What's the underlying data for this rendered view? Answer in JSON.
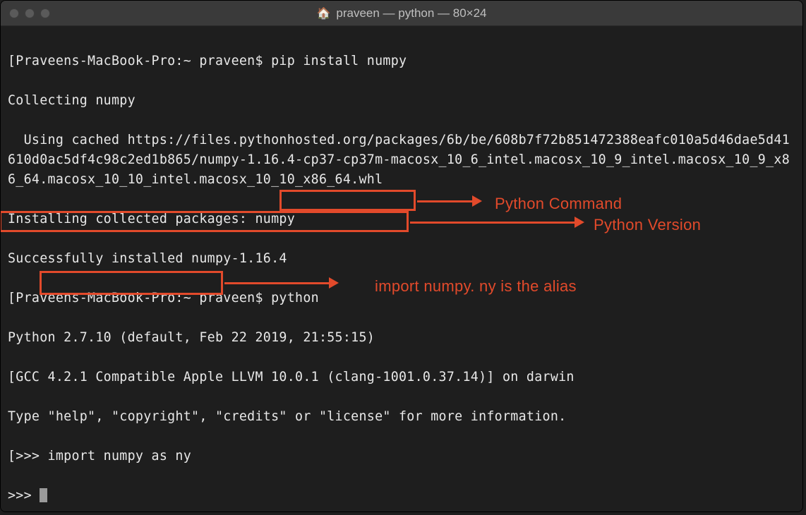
{
  "window": {
    "title": "praveen — python — 80×24",
    "home_icon": "🏠"
  },
  "terminal": {
    "lines": {
      "l0_prompt_prefix": "[Praveens-MacBook-Pro:~ praveen$ ",
      "l0_cmd": "pip install numpy",
      "l1": "Collecting numpy",
      "l2": "  Using cached https://files.pythonhosted.org/packages/6b/be/608b7f72b851472388eafc010a5d46dae5d41610d0ac5df4c98c2ed1b865/numpy-1.16.4-cp37-cp37m-macosx_10_6_intel.macosx_10_9_intel.macosx_10_9_x86_64.macosx_10_10_intel.macosx_10_10_x86_64.whl",
      "l3": "Installing collected packages: numpy",
      "l4": "Successfully installed numpy-1.16.4",
      "l5_prompt_prefix": "[Praveens-MacBook-Pro:~ praveen$ ",
      "l5_cmd": "python",
      "l6": "Python 2.7.10 (default, Feb 22 2019, 21:55:15)",
      "l7": "[GCC 4.2.1 Compatible Apple LLVM 10.0.1 (clang-1001.0.37.14)] on darwin",
      "l8": "Type \"help\", \"copyright\", \"credits\" or \"license\" for more information.",
      "l9_prompt": "[>>> ",
      "l9_cmd": "import numpy as ny",
      "l10_prompt": ">>> "
    }
  },
  "annotations": {
    "a1": "Python Command",
    "a2": "Python Version",
    "a3": "import numpy. ny is the alias"
  }
}
